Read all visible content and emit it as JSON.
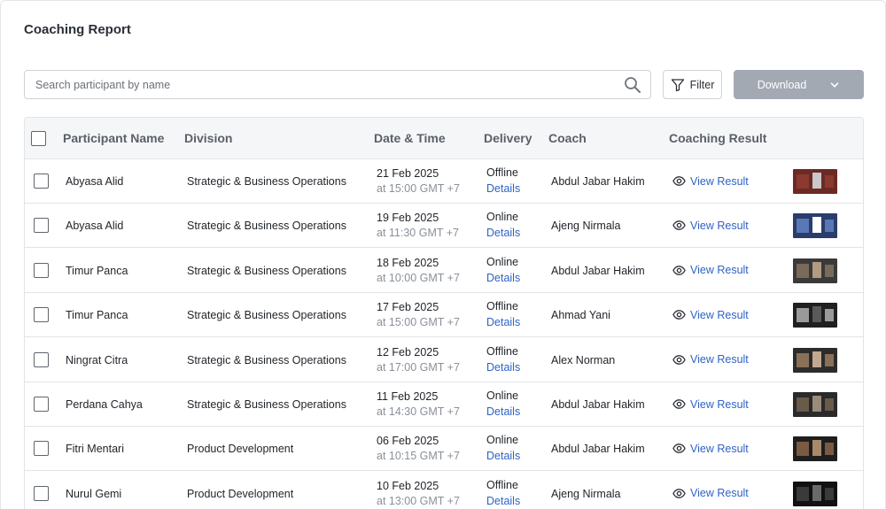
{
  "page": {
    "title": "Coaching Report"
  },
  "toolbar": {
    "search_placeholder": "Search participant by name",
    "search_icon": "search-icon",
    "filter_label": "Filter",
    "filter_icon": "funnel-icon",
    "download_label": "Download",
    "download_icon": "chevron-down-icon"
  },
  "table": {
    "headers": {
      "participant": "Participant Name",
      "division": "Division",
      "datetime": "Date & Time",
      "delivery": "Delivery",
      "coach": "Coach",
      "result": "Coaching Result"
    },
    "details_label": "Details",
    "view_result_label": "View Result",
    "view_icon": "eye-icon",
    "rows": [
      {
        "name": "Abyasa Alid",
        "division": "Strategic & Business Operations",
        "date": "21 Feb 2025",
        "time": "at 15:00 GMT +7",
        "delivery": "Offline",
        "coach": "Abdul Jabar Hakim"
      },
      {
        "name": "Abyasa Alid",
        "division": "Strategic & Business Operations",
        "date": "19 Feb 2025",
        "time": "at 11:30 GMT +7",
        "delivery": "Online",
        "coach": "Ajeng Nirmala"
      },
      {
        "name": "Timur Panca",
        "division": "Strategic & Business Operations",
        "date": "18 Feb 2025",
        "time": "at 10:00 GMT +7",
        "delivery": "Online",
        "coach": "Abdul Jabar Hakim"
      },
      {
        "name": "Timur Panca",
        "division": "Strategic & Business Operations",
        "date": "17 Feb 2025",
        "time": "at 15:00 GMT +7",
        "delivery": "Offline",
        "coach": "Ahmad Yani"
      },
      {
        "name": "Ningrat Citra",
        "division": "Strategic & Business Operations",
        "date": "12 Feb 2025",
        "time": "at 17:00 GMT +7",
        "delivery": "Offline",
        "coach": "Alex Norman"
      },
      {
        "name": "Perdana Cahya",
        "division": "Strategic & Business Operations",
        "date": "11 Feb 2025",
        "time": "at 14:30 GMT +7",
        "delivery": "Online",
        "coach": "Abdul Jabar Hakim"
      },
      {
        "name": "Fitri Mentari",
        "division": "Product Development",
        "date": "06 Feb 2025",
        "time": "at 10:15 GMT +7",
        "delivery": "Online",
        "coach": "Abdul Jabar Hakim"
      },
      {
        "name": "Nurul Gemi",
        "division": "Product Development",
        "date": "10 Feb 2025",
        "time": "at 13:00 GMT +7",
        "delivery": "Offline",
        "coach": "Ajeng Nirmala"
      }
    ]
  },
  "colors": {
    "link": "#2f63c4",
    "download_bg": "#a3a9b3",
    "header_bg": "#f5f6f7"
  }
}
